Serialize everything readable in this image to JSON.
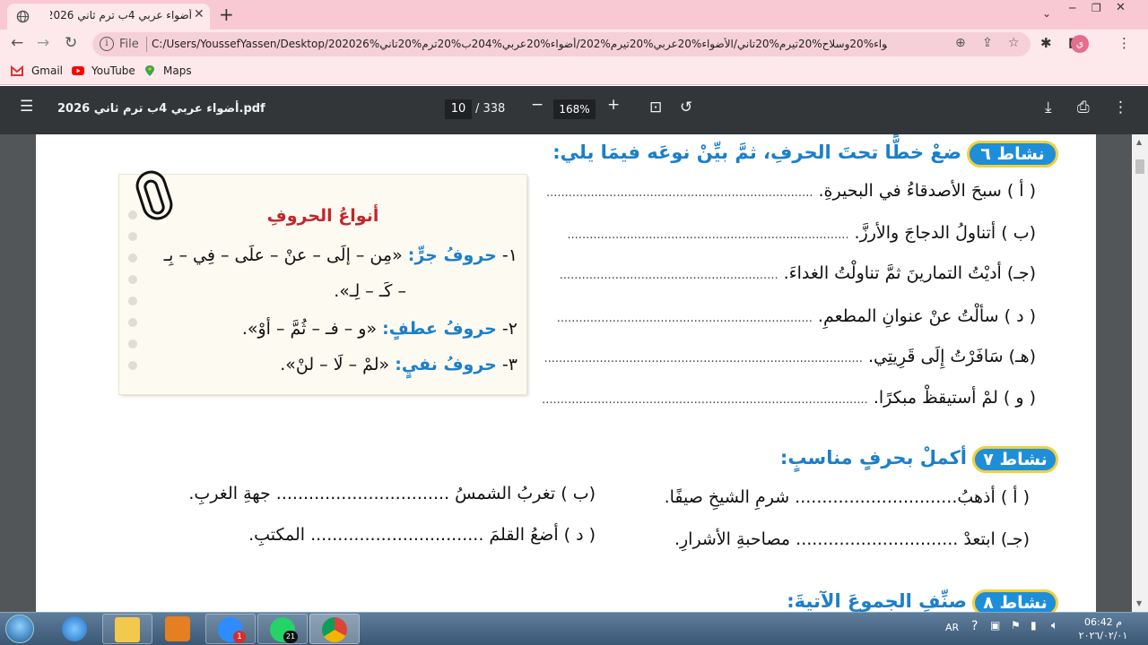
{
  "browser": {
    "tab_title": "أضواء عربي 4ب ترم ثاني 2026.pdf",
    "file_label": "File",
    "url": "C:/Users/YoussefYassen/Desktop/202026%الاضواء%20وسلاح%20تيرم%20تاني/الأضواء%20عربي%20تيرم%202/أضواء%20عربي%204ب%20ترم%20تاني.pdf",
    "profile_initial": "ي",
    "bookmarks": [
      {
        "label": "Gmail"
      },
      {
        "label": "YouTube"
      },
      {
        "label": "Maps"
      }
    ]
  },
  "pdf_toolbar": {
    "file_name": "أضواء عربي 4ب ترم ثاني 2026.pdf",
    "current_page": "10",
    "total_pages": "/ 338",
    "zoom": "168%"
  },
  "page": {
    "activity6": {
      "badge": "نشاط ٦",
      "heading": "ضعْ خطًّا تحتَ الحرفِ، ثمَّ بيِّنْ نوعَه فيمَا يلي:",
      "items": [
        {
          "label": "( أ ) سبحَ الأصدقاءُ في البحيرةِ.",
          "dots": "........................................................................"
        },
        {
          "label": "(ب ) أتناولُ الدجاجَ والأرزَّ.",
          "dots": "............................................................................"
        },
        {
          "label": "(جـ) أديْتُ التمارينَ ثمَّ تناولْتُ الغداءَ.",
          "dots": "..........................................................."
        },
        {
          "label": "( د ) سألْتُ عنْ عنوانِ المطعمِ.",
          "dots": "....................................................................."
        },
        {
          "label": "(هـ) سَافَرْتُ إِلَى قَرِيتِي.",
          "dots": "......................................................................................"
        },
        {
          "label": "( و ) لمْ أستيقظْ مبكرًا.",
          "dots": "........................................................................................"
        }
      ]
    },
    "note": {
      "title": "أنواعُ الحروفِ",
      "line1_num": "١-",
      "line1_type": "حروفُ جرٍّ:",
      "line1_text": "«مِن – إلَى – عنْ – علَى – فِي – بِـ",
      "line1_cont": "– كَـ – لِـ».",
      "line2_num": "٢-",
      "line2_type": "حروفُ عطفٍ:",
      "line2_text": "«و – فـ – ثُمَّ – أوْ».",
      "line3_num": "٣-",
      "line3_type": "حروفُ نفيٍ:",
      "line3_text": "«لمْ – لَا – لنْ»."
    },
    "activity7": {
      "badge": "نشاط ٧",
      "heading": "أكملْ بحرفٍ مناسبٍ:",
      "items": [
        {
          "text": "( أ ) أذهبُ.............................. شرمِ الشيخِ صيفًا."
        },
        {
          "text": "(ب ) تغربُ الشمسُ ................................ جهةِ الغربِ."
        },
        {
          "text": "(جـ) ابتعدْ .............................. مصاحبةِ الأشرارِ."
        },
        {
          "text": "( د ) أضعُ القلمَ ................................ المكتبِ."
        }
      ]
    },
    "activity8": {
      "badge": "نشاط ٨",
      "heading": "صنِّفِ الجموعَ الآتيةَ:"
    }
  },
  "taskbar": {
    "zoom_badge": "1",
    "whatsapp_badge": "21",
    "language": "AR",
    "time": "06:42 م",
    "date": "٢٠٢٦/٠٢/٠١"
  }
}
